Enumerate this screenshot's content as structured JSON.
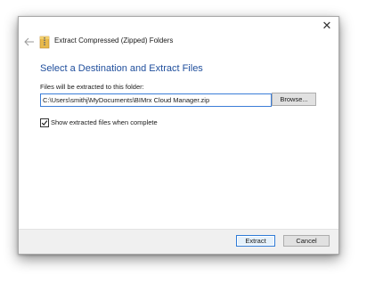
{
  "window": {
    "close_glyph": "✕",
    "title": "Extract Compressed (Zipped) Folders"
  },
  "content": {
    "heading": "Select a Destination and Extract Files",
    "path_label": "Files will be extracted to this folder:",
    "path_value": "C:\\Users\\smithj\\MyDocuments\\BIMrx Cloud Manager.zip",
    "browse_label": "Browse...",
    "show_files_label": "Show extracted files when complete",
    "show_files_checked": true
  },
  "footer": {
    "extract_label": "Extract",
    "cancel_label": "Cancel"
  },
  "colors": {
    "heading": "#1f4e9c",
    "focus_border": "#3b7dd8",
    "default_button_border": "#2f7bd6"
  },
  "icons": {
    "back": "back-arrow-icon",
    "zip": "zip-folder-icon",
    "close": "close-icon",
    "check": "checkmark-icon"
  }
}
